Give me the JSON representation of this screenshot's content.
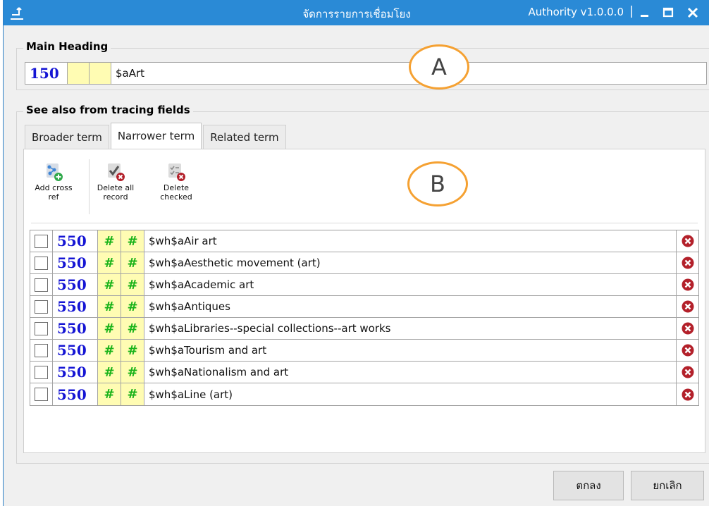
{
  "window": {
    "title": "จัดการรายการเชื่อมโยง",
    "app_version": "Authority v1.0.0.0",
    "separator": "|",
    "minimize_glyph": "–",
    "maximize_glyph": "☐",
    "close_glyph": "✕"
  },
  "main_heading": {
    "label": "Main Heading",
    "tag": "150",
    "indicator1": "",
    "indicator2": "",
    "data": "$aArt"
  },
  "see_also": {
    "label": "See also from tracing fields",
    "tabs": [
      {
        "label": "Broader term",
        "active": false
      },
      {
        "label": "Narrower term",
        "active": true
      },
      {
        "label": "Related term",
        "active": false
      }
    ]
  },
  "toolbar": {
    "add_cross_ref": "Add cross ref",
    "delete_all_record": "Delete all record",
    "delete_checked": "Delete checked"
  },
  "rows": [
    {
      "tag": "550",
      "ind1": "#",
      "ind2": "#",
      "data": "$wh$aAir art"
    },
    {
      "tag": "550",
      "ind1": "#",
      "ind2": "#",
      "data": "$wh$aAesthetic movement (art)"
    },
    {
      "tag": "550",
      "ind1": "#",
      "ind2": "#",
      "data": "$wh$aAcademic art"
    },
    {
      "tag": "550",
      "ind1": "#",
      "ind2": "#",
      "data": "$wh$aAntiques"
    },
    {
      "tag": "550",
      "ind1": "#",
      "ind2": "#",
      "data": "$wh$aLibraries--special collections--art works"
    },
    {
      "tag": "550",
      "ind1": "#",
      "ind2": "#",
      "data": "$wh$aTourism and art"
    },
    {
      "tag": "550",
      "ind1": "#",
      "ind2": "#",
      "data": "$wh$aNationalism and art"
    },
    {
      "tag": "550",
      "ind1": "#",
      "ind2": "#",
      "data": "$wh$aLine (art)"
    }
  ],
  "annotations": {
    "a": "A",
    "b": "B"
  },
  "buttons": {
    "ok": "ตกลง",
    "cancel": "ยกเลิก"
  },
  "colors": {
    "titlebar": "#2a8ad6",
    "tag_text": "#1515d4",
    "indicator_bg": "#fffcb3",
    "indicator_text": "#19b319",
    "delete_icon": "#b3202a",
    "callout_border": "#f5a132"
  }
}
